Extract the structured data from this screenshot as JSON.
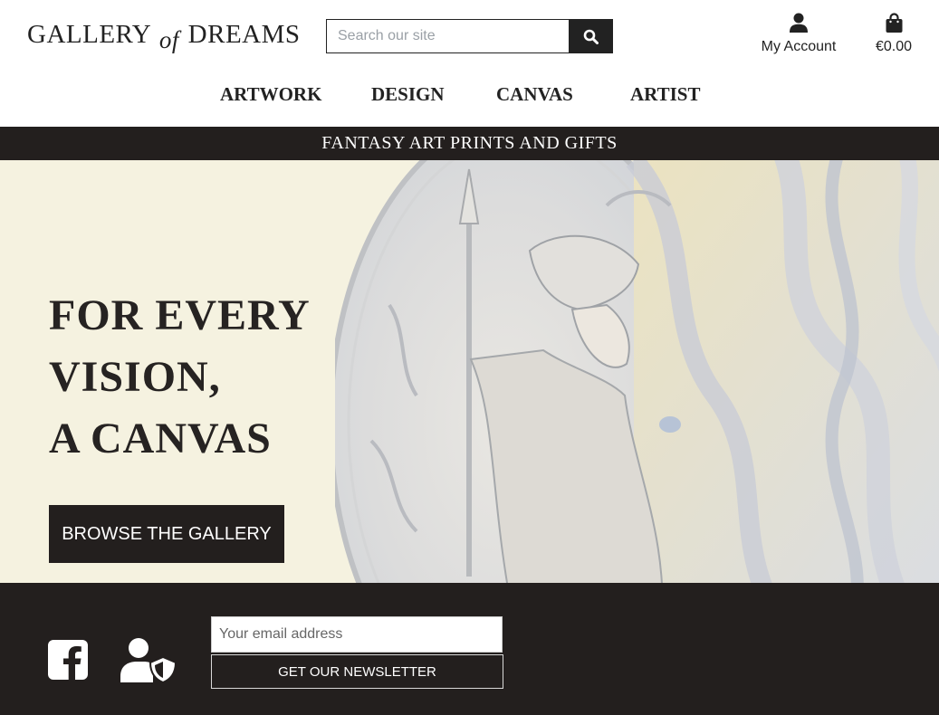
{
  "header": {
    "logo": {
      "part1": "GALLERY",
      "part2": "of",
      "part3": "DREAMS"
    },
    "search": {
      "placeholder": "Search our site",
      "value": ""
    },
    "account_label": "My Account",
    "bag_total": "€0.00"
  },
  "nav": {
    "items": [
      {
        "label": "ARTWORK"
      },
      {
        "label": "DESIGN"
      },
      {
        "label": "CANVAS"
      },
      {
        "label": "ARTIST"
      }
    ]
  },
  "banner": {
    "text": "FANTASY ART PRINTS AND GIFTS"
  },
  "hero": {
    "title_lines": [
      "FOR EVERY",
      "VISION,",
      "A CANVAS"
    ],
    "cta_label": "BROWSE THE GALLERY"
  },
  "footer": {
    "email_placeholder": "Your email address",
    "newsletter_label": "GET OUR NEWSLETTER"
  },
  "icons": {
    "search": "search-icon",
    "account": "user-icon",
    "bag": "shopping-bag-icon",
    "facebook": "facebook-icon",
    "privacy": "user-shield-icon"
  },
  "colors": {
    "dark": "#231f1e",
    "hero_bg": "#f5f2e0",
    "text": "#222222",
    "white": "#ffffff"
  }
}
